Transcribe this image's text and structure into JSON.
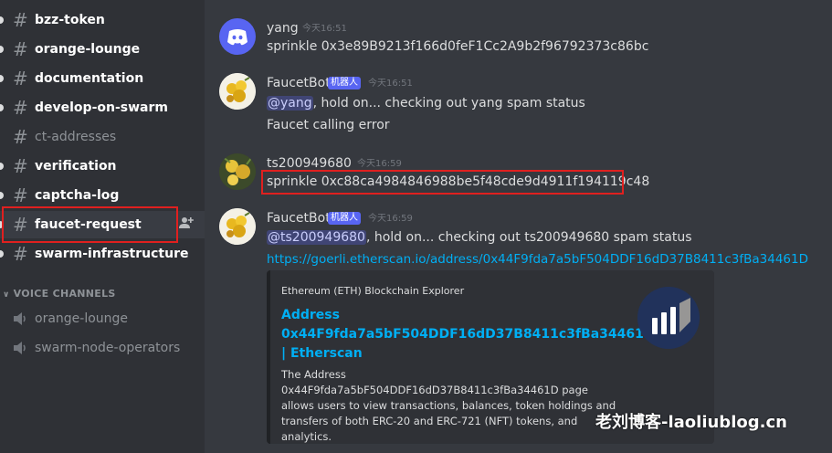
{
  "sidebar": {
    "text_channels": [
      {
        "name": "bzz-token",
        "unread": true
      },
      {
        "name": "orange-lounge",
        "unread": true
      },
      {
        "name": "documentation",
        "unread": true
      },
      {
        "name": "develop-on-swarm",
        "unread": true
      },
      {
        "name": "ct-addresses",
        "unread": false
      },
      {
        "name": "verification",
        "unread": true
      },
      {
        "name": "captcha-log",
        "unread": true
      },
      {
        "name": "faucet-request",
        "unread": true,
        "selected": true
      },
      {
        "name": "swarm-infrastructure",
        "unread": true
      }
    ],
    "voice_section_title": "VOICE CHANNELS",
    "voice_channels": [
      "orange-lounge",
      "swarm-node-operators"
    ],
    "hash_glyph": "#",
    "add_member_icon": "add-member-icon"
  },
  "messages": [
    {
      "author": "yang",
      "timestamp": "今天16:51",
      "lines": [
        "sprinkle 0x3e89B9213f166d0feF1Cc2A9b2f96792373c86bc"
      ],
      "avatar": "discord-default-avatar"
    },
    {
      "author": "FaucetBot",
      "badge": "机器人",
      "timestamp": "今天16:51",
      "mention": "@yang",
      "line1_rest": ", hold on... checking out yang spam status",
      "line2": "Faucet calling error",
      "avatar": "faucetbot-avatar"
    },
    {
      "author": "ts200949680",
      "timestamp": "今天16:59",
      "lines": [
        "sprinkle  0xc88ca4984846988be5f48cde9d4911f194119c48"
      ],
      "avatar": "user-avatar"
    },
    {
      "author": "FaucetBot",
      "badge": "机器人",
      "timestamp": "今天16:59",
      "mention": "@ts200949680",
      "line1_rest": ", hold on... checking out ts200949680 spam status",
      "link": "https://goerli.etherscan.io/address/0x44F9fda7a5bF504DDF16dD37B8411c3fBa34461D",
      "avatar": "faucetbot-avatar"
    }
  ],
  "embed": {
    "provider": "Ethereum (ETH) Blockchain Explorer",
    "title": "Address 0x44F9fda7a5bF504DDF16dD37B8411c3fBa34461D | Etherscan",
    "description": "The Address 0x44F9fda7a5bF504DDF16dD37B8411c3fBa34461D page allows users to view transactions, balances, token holdings and transfers of both ERC-20 and ERC-721 (NFT) tokens, and analytics.",
    "thumbnail": "etherscan-logo-icon"
  },
  "watermark": "老刘博客-laoliublog.cn",
  "colors": {
    "highlight_box": "#e0201f",
    "link": "#00aff4",
    "bot_badge": "#5865f2",
    "sidebar_bg": "#2f3136",
    "chat_bg": "#36393f"
  }
}
